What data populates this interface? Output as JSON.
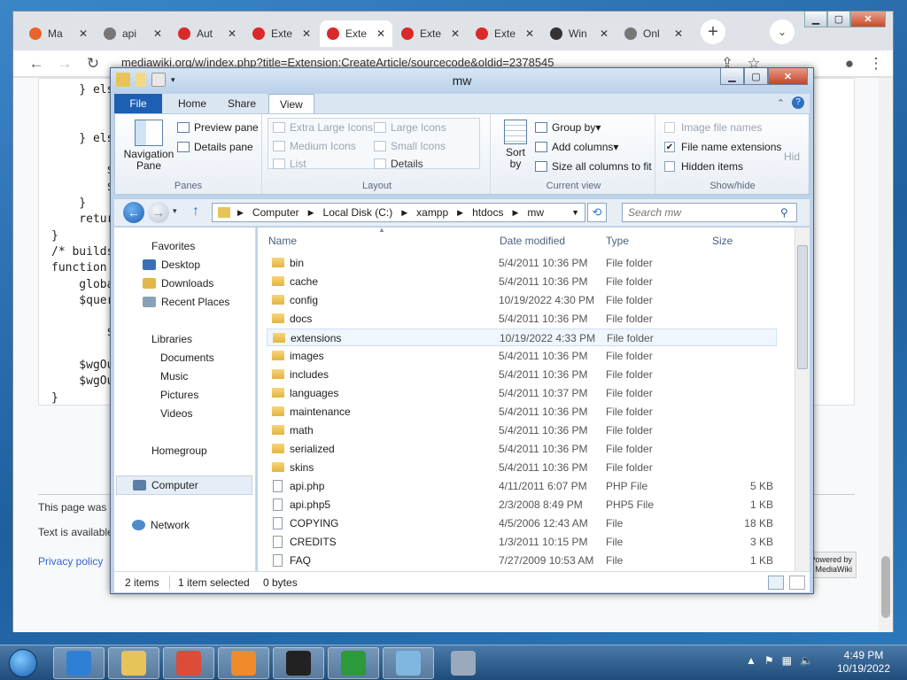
{
  "browser": {
    "tabs": [
      {
        "label": "Ma",
        "icon": "xampp-icon",
        "color": "#e8642c"
      },
      {
        "label": "api",
        "icon": "globe-icon",
        "color": "#777777"
      },
      {
        "label": "Aut",
        "icon": "opera-icon",
        "color": "#d92a2a"
      },
      {
        "label": "Exte",
        "icon": "opera-icon",
        "color": "#d92a2a"
      },
      {
        "label": "Exte",
        "icon": "opera-icon",
        "color": "#d92a2a",
        "active": true
      },
      {
        "label": "Exte",
        "icon": "opera-icon",
        "color": "#d92a2a"
      },
      {
        "label": "Exte",
        "icon": "opera-icon",
        "color": "#d92a2a"
      },
      {
        "label": "Win",
        "icon": "museum-icon",
        "color": "#333333"
      },
      {
        "label": "Onl",
        "icon": "globe-icon",
        "color": "#777777"
      }
    ],
    "url": "mediawiki.org/w/index.php?title=Extension:CreateArticle/sourcecode&oldid=2378545",
    "code_lines": [
      "    } else {",
      "",
      "",
      "    } else",
      "",
      "        $",
      "        $",
      "    }",
      "    retur",
      "}",
      "/* builds",
      "function",
      "    globa",
      "    $quer",
      "        ",
      "        $",
      "",
      "    $wgOu",
      "    $wgOu",
      "}"
    ],
    "footer": {
      "line1": "This page was",
      "line2": "Text is available",
      "privacy": "Privacy policy",
      "badge": "Powered by MediaWiki"
    }
  },
  "explorer": {
    "title": "mw",
    "ribbon_tabs": [
      "File",
      "Home",
      "Share",
      "View"
    ],
    "panes_group": {
      "label": "Panes",
      "nav_pane": "Navigation Pane",
      "preview_pane": "Preview pane",
      "details_pane": "Details pane"
    },
    "layout_group": {
      "label": "Layout",
      "items": [
        "Extra Large Icons",
        "Large Icons",
        "Medium Icons",
        "Small Icons",
        "List",
        "Details"
      ]
    },
    "current_view_group": {
      "label": "Current view",
      "sort": "Sort by",
      "group_by": "Group by",
      "add_columns": "Add columns",
      "size_all": "Size all columns to fit"
    },
    "showhide_group": {
      "label": "Show/hide",
      "image_names": "Image file names",
      "file_ext": "File name extensions",
      "hidden": "Hidden items",
      "hide_cut": "Hid"
    },
    "breadcrumbs": [
      "Computer",
      "Local Disk (C:)",
      "xampp",
      "htdocs",
      "mw"
    ],
    "search_placeholder": "Search mw",
    "nav": {
      "favorites": "Favorites",
      "desktop": "Desktop",
      "downloads": "Downloads",
      "recent": "Recent Places",
      "libraries": "Libraries",
      "documents": "Documents",
      "music": "Music",
      "pictures": "Pictures",
      "videos": "Videos",
      "homegroup": "Homegroup",
      "computer": "Computer",
      "network": "Network"
    },
    "columns": [
      "Name",
      "Date modified",
      "Type",
      "Size"
    ],
    "files": [
      {
        "name": "bin",
        "date": "5/4/2011 10:36 PM",
        "type": "File folder",
        "size": "",
        "kind": "folder"
      },
      {
        "name": "cache",
        "date": "5/4/2011 10:36 PM",
        "type": "File folder",
        "size": "",
        "kind": "folder"
      },
      {
        "name": "config",
        "date": "10/19/2022 4:30 PM",
        "type": "File folder",
        "size": "",
        "kind": "folder"
      },
      {
        "name": "docs",
        "date": "5/4/2011 10:36 PM",
        "type": "File folder",
        "size": "",
        "kind": "folder"
      },
      {
        "name": "extensions",
        "date": "10/19/2022 4:33 PM",
        "type": "File folder",
        "size": "",
        "kind": "folder"
      },
      {
        "name": "images",
        "date": "5/4/2011 10:36 PM",
        "type": "File folder",
        "size": "",
        "kind": "folder"
      },
      {
        "name": "includes",
        "date": "5/4/2011 10:36 PM",
        "type": "File folder",
        "size": "",
        "kind": "folder"
      },
      {
        "name": "languages",
        "date": "5/4/2011 10:37 PM",
        "type": "File folder",
        "size": "",
        "kind": "folder"
      },
      {
        "name": "maintenance",
        "date": "5/4/2011 10:36 PM",
        "type": "File folder",
        "size": "",
        "kind": "folder"
      },
      {
        "name": "math",
        "date": "5/4/2011 10:36 PM",
        "type": "File folder",
        "size": "",
        "kind": "folder"
      },
      {
        "name": "serialized",
        "date": "5/4/2011 10:36 PM",
        "type": "File folder",
        "size": "",
        "kind": "folder"
      },
      {
        "name": "skins",
        "date": "5/4/2011 10:36 PM",
        "type": "File folder",
        "size": "",
        "kind": "folder"
      },
      {
        "name": "api.php",
        "date": "4/11/2011 6:07 PM",
        "type": "PHP File",
        "size": "5 KB",
        "kind": "file"
      },
      {
        "name": "api.php5",
        "date": "2/3/2008 8:49 PM",
        "type": "PHP5 File",
        "size": "1 KB",
        "kind": "file"
      },
      {
        "name": "COPYING",
        "date": "4/5/2006 12:43 AM",
        "type": "File",
        "size": "18 KB",
        "kind": "file"
      },
      {
        "name": "CREDITS",
        "date": "1/3/2011 10:15 PM",
        "type": "File",
        "size": "3 KB",
        "kind": "file"
      },
      {
        "name": "FAQ",
        "date": "7/27/2009 10:53 AM",
        "type": "File",
        "size": "1 KB",
        "kind": "file"
      }
    ],
    "status": {
      "items": "2 items",
      "selected": "1 item selected",
      "bytes": "0 bytes"
    }
  },
  "taskbar": {
    "apps": [
      "ie-icon",
      "explorer-icon",
      "chrome-icon",
      "xampp-icon",
      "7zip-icon",
      "idm-icon",
      "notepad-icon",
      "archive-icon"
    ],
    "time": "4:49 PM",
    "date": "10/19/2022"
  }
}
